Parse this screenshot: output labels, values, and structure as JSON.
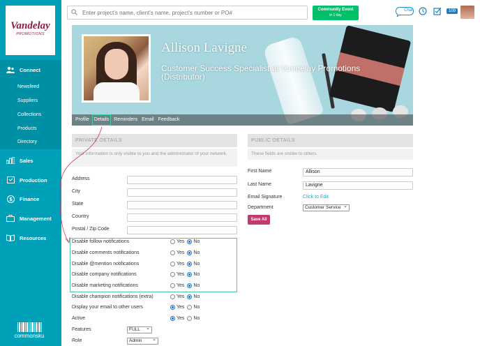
{
  "sidebar": {
    "logo_text": "Vandelay",
    "logo_sub": "PROMOTIONS",
    "sections": [
      {
        "label": "Connect",
        "icon": "users-icon"
      },
      {
        "label": "Sales",
        "icon": "bar-chart-icon"
      },
      {
        "label": "Production",
        "icon": "box-icon"
      },
      {
        "label": "Finance",
        "icon": "dollar-icon"
      },
      {
        "label": "Management",
        "icon": "briefcase-icon"
      },
      {
        "label": "Resources",
        "icon": "book-icon"
      }
    ],
    "connect_items": [
      "Newsfeed",
      "Suppliers",
      "Collections",
      "Products",
      "Directory"
    ],
    "brand": "commonsku"
  },
  "header": {
    "search_placeholder": "Enter project's name, client's name, project's number or PO#",
    "event_label": "Community Event",
    "event_sub": "in 1 day",
    "chat_label": "Chat",
    "badge_count": "109"
  },
  "profile": {
    "name": "Allison Lavigne",
    "title": "Customer Success Specialist at Vandelay Promotions (Distributor)",
    "tabs": [
      "Profile",
      "Details",
      "Reminders",
      "Email",
      "Feedback"
    ],
    "active_tab": "Details"
  },
  "private": {
    "heading": "PRIVATE DETAILS",
    "note": "Your information is only visible to you and the administrator of your network.",
    "fields": [
      "Address",
      "City",
      "State",
      "Country",
      "Postal / Zip Code"
    ],
    "yes": "Yes",
    "no": "No",
    "toggles": [
      {
        "label": "Disable follow notifications",
        "value": "No"
      },
      {
        "label": "Disable comments notifications",
        "value": "No"
      },
      {
        "label": "Disable @mention notifications",
        "value": "No"
      },
      {
        "label": "Disable company notifications",
        "value": "No"
      },
      {
        "label": "Disable marketing notifications",
        "value": "No"
      },
      {
        "label": "Disable champion notifications (extra)",
        "value": "No"
      },
      {
        "label": "Display your email to other users",
        "value": "Yes"
      },
      {
        "label": "Active",
        "value": "Yes"
      }
    ],
    "features_label": "Features",
    "features_value": "FULL",
    "role_label": "Role",
    "role_value": "Admin"
  },
  "public": {
    "heading": "PUBLIC DETAILS",
    "note": "These fields are visible to others.",
    "first_name_label": "First Name",
    "first_name": "Allison",
    "last_name_label": "Last Name",
    "last_name": "Lavigne",
    "signature_label": "Email Signature",
    "signature_link": "Click to Edit",
    "department_label": "Department",
    "department_value": "Customer Service",
    "save_label": "Save All"
  },
  "colors": {
    "sidebar": "#00a0b8",
    "accent_green": "#00c06a",
    "save": "#c2396c",
    "highlight": "#55c8a0",
    "arrow": "#c2396c"
  }
}
